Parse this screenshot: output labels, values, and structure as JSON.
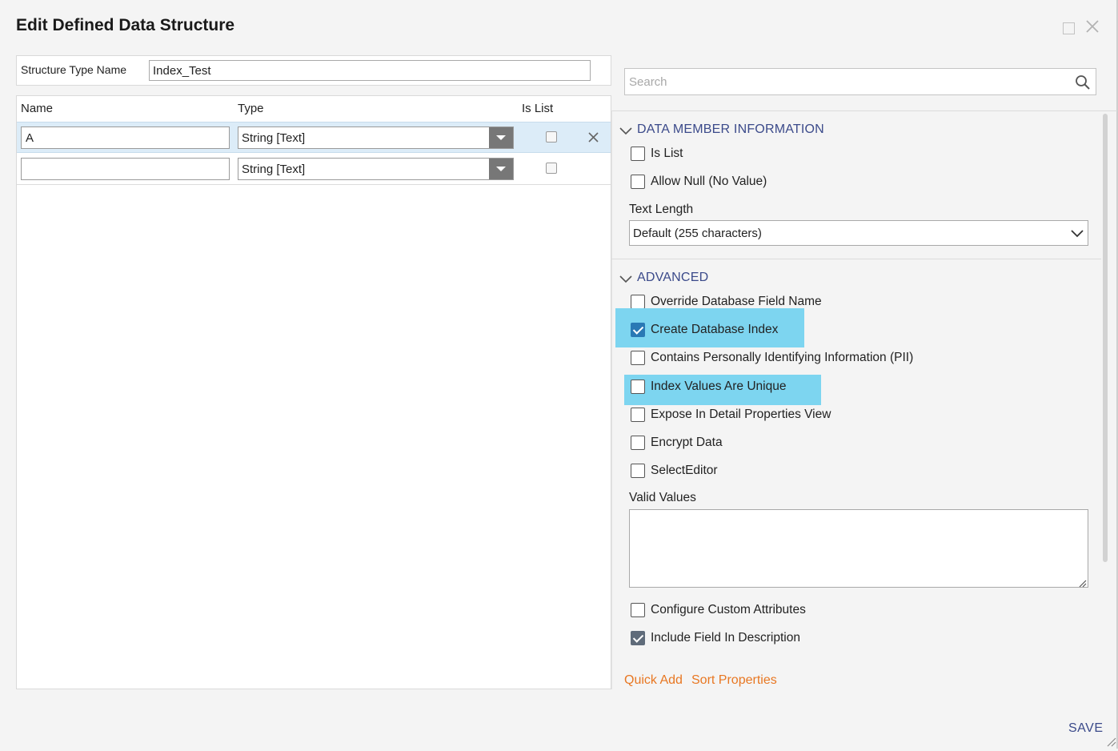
{
  "dialog": {
    "title": "Edit Defined Data Structure"
  },
  "structure": {
    "name_label": "Structure Type Name",
    "name_value": "Index_Test"
  },
  "grid": {
    "headers": {
      "name": "Name",
      "type": "Type",
      "is_list": "Is List"
    },
    "rows": [
      {
        "name": "A",
        "type": "String [Text]",
        "is_list": false,
        "selected": true
      },
      {
        "name": "",
        "type": "String [Text]",
        "is_list": false,
        "selected": false
      }
    ]
  },
  "search": {
    "placeholder": "Search"
  },
  "data_member_info": {
    "title": "DATA MEMBER INFORMATION",
    "is_list": "Is List",
    "allow_null": "Allow Null (No Value)",
    "text_length_label": "Text Length",
    "text_length_value": "Default (255 characters)"
  },
  "advanced": {
    "title": "ADVANCED",
    "options": [
      {
        "label": "Override Database Field Name",
        "checked": false,
        "highlighted": false
      },
      {
        "label": "Create Database Index",
        "checked": true,
        "highlighted": true
      },
      {
        "label": "Contains Personally Identifying Information (PII)",
        "checked": false,
        "highlighted": false
      },
      {
        "label": "Index Values Are Unique",
        "checked": false,
        "highlighted": true
      },
      {
        "label": "Expose In Detail Properties View",
        "checked": false,
        "highlighted": false
      },
      {
        "label": "Encrypt Data",
        "checked": false,
        "highlighted": false
      },
      {
        "label": "SelectEditor",
        "checked": false,
        "highlighted": false
      }
    ],
    "valid_values_label": "Valid Values",
    "configure_custom_attributes": "Configure Custom Attributes",
    "include_field_in_description": "Include Field In Description"
  },
  "links": {
    "quick_add": "Quick Add",
    "sort_properties": "Sort Properties"
  },
  "footer": {
    "save": "SAVE"
  },
  "colors": {
    "highlight": "#7dd5f0",
    "link": "#e87722",
    "section_heading": "#3b4a8a",
    "selected_row": "#dcecf8"
  }
}
